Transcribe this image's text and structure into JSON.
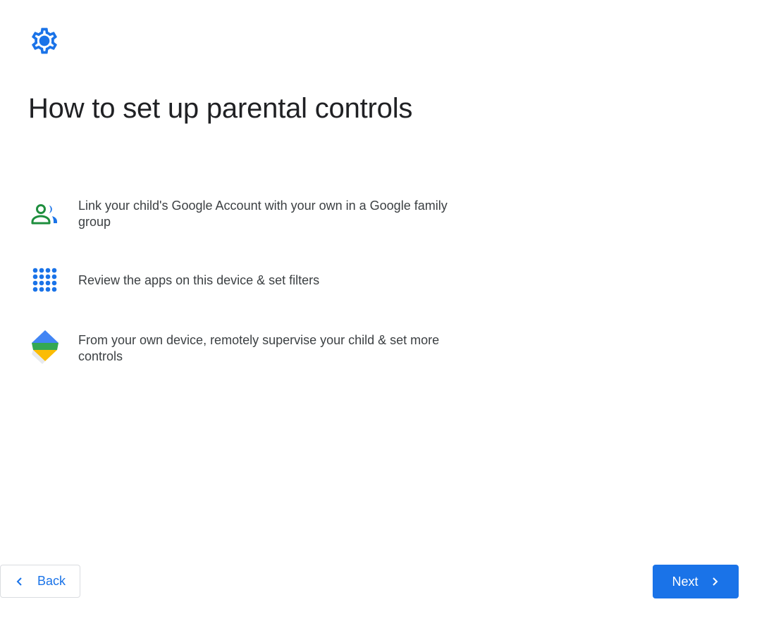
{
  "header": {
    "icon": "gear-icon",
    "title": "How to set up parental controls"
  },
  "steps": [
    {
      "icon": "family-group-icon",
      "text": "Link your child's Google Account with your own in a Google family group"
    },
    {
      "icon": "apps-grid-icon",
      "text": "Review the apps on this device & set filters"
    },
    {
      "icon": "family-link-icon",
      "text": "From your own device, remotely supervise your child & set more controls"
    }
  ],
  "footer": {
    "back_label": "Back",
    "next_label": "Next"
  },
  "colors": {
    "accent": "#1a73e8",
    "title": "#202124",
    "body_text": "#3c4043",
    "green": "#1e8e3e",
    "yellow": "#fbbc04",
    "border": "#dadce0"
  }
}
